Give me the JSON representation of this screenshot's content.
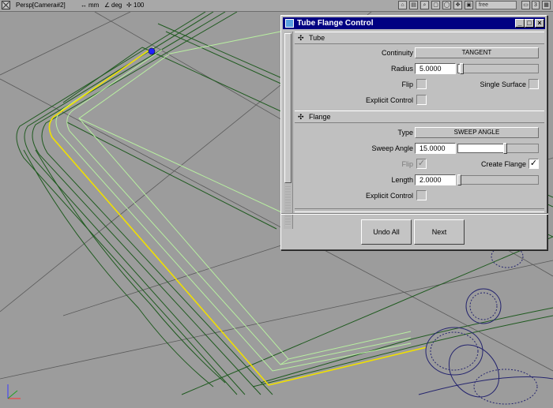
{
  "viewport_header": {
    "camera_label": "Persp[Camera#2]",
    "linear_unit": "mm",
    "angular_unit": "deg",
    "tolerance": "100",
    "mode_field": "free",
    "counter": "3"
  },
  "dialog": {
    "title": "Tube Flange Control",
    "tube_section": {
      "title": "Tube",
      "continuity_label": "Continuity",
      "continuity_value": "TANGENT",
      "radius_label": "Radius",
      "radius_value": "5.0000",
      "radius_slider_fraction": 0.05,
      "flip_label": "Flip",
      "single_surface_label": "Single Surface",
      "explicit_control_label": "Explicit Control"
    },
    "flange_section": {
      "title": "Flange",
      "type_label": "Type",
      "type_value": "SWEEP ANGLE",
      "sweep_angle_label": "Sweep Angle",
      "sweep_angle_value": "15.0000",
      "sweep_slider_fraction": 0.58,
      "flip_label": "Flip",
      "create_flange_label": "Create Flange",
      "create_flange_checked": true,
      "length_label": "Length",
      "length_value": "2.0000",
      "length_slider_fraction": 0.02,
      "explicit_control_label": "Explicit Control"
    },
    "undo_all_label": "Undo All",
    "next_label": "Next"
  },
  "colors": {
    "title_bar": "#000082",
    "viewport_bg": "#9c9c9c",
    "dark_curve": "#1f5a1f",
    "light_curve": "#b8f0a0",
    "selected_curve": "#f0e000",
    "hole_curve": "#24246e"
  }
}
